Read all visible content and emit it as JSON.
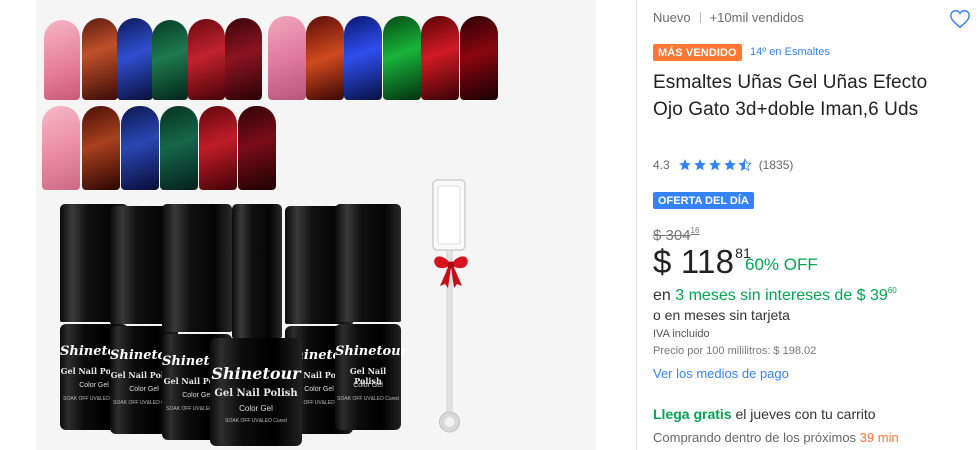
{
  "product": {
    "condition": "Nuevo",
    "sold": "+10mil vendidos",
    "best_seller_badge": "MÁS VENDIDO",
    "rank_label": "14º en Esmaltes",
    "title": "Esmaltes Uñas Gel Uñas Efecto Ojo Gato 3d+doble Iman,6 Uds",
    "rating_value": "4.3",
    "rating_stars": 4.5,
    "rating_count": "(1835)",
    "deal_badge": "OFERTA DEL DÍA",
    "old_price_main": "$ 304",
    "old_price_cents": "16",
    "price_main": "$ 118",
    "price_cents": "81",
    "discount": "60% OFF",
    "installments_prefix": "en",
    "installments_text": "3 meses sin intereses de $ 39",
    "installments_cents": "60",
    "no_card_text": "o en meses sin tarjeta",
    "tax_note": "IVA incluido",
    "unit_price": "Precio por 100 mililitros: $ 198.02",
    "payment_link": "Ver los medios de pago",
    "shipping_free": "Llega gratis",
    "shipping_rest": " el jueves con tu carrito",
    "countdown_prefix": "Comprando dentro de los próximos ",
    "countdown_time": "39 min"
  },
  "bottles": {
    "brand": "Shinetour",
    "line1": "Gel Nail Polish",
    "line2": "Color Gel",
    "line3": "SOAK OFF UV&LED Cured"
  },
  "colors": {
    "accent_blue": "#3483fa",
    "green": "#00a650",
    "orange": "#ff7733",
    "star": "#3483fa"
  },
  "icons": {
    "favorite": "heart-outline-icon",
    "star": "star-icon",
    "gift": "gift-bow-icon"
  }
}
